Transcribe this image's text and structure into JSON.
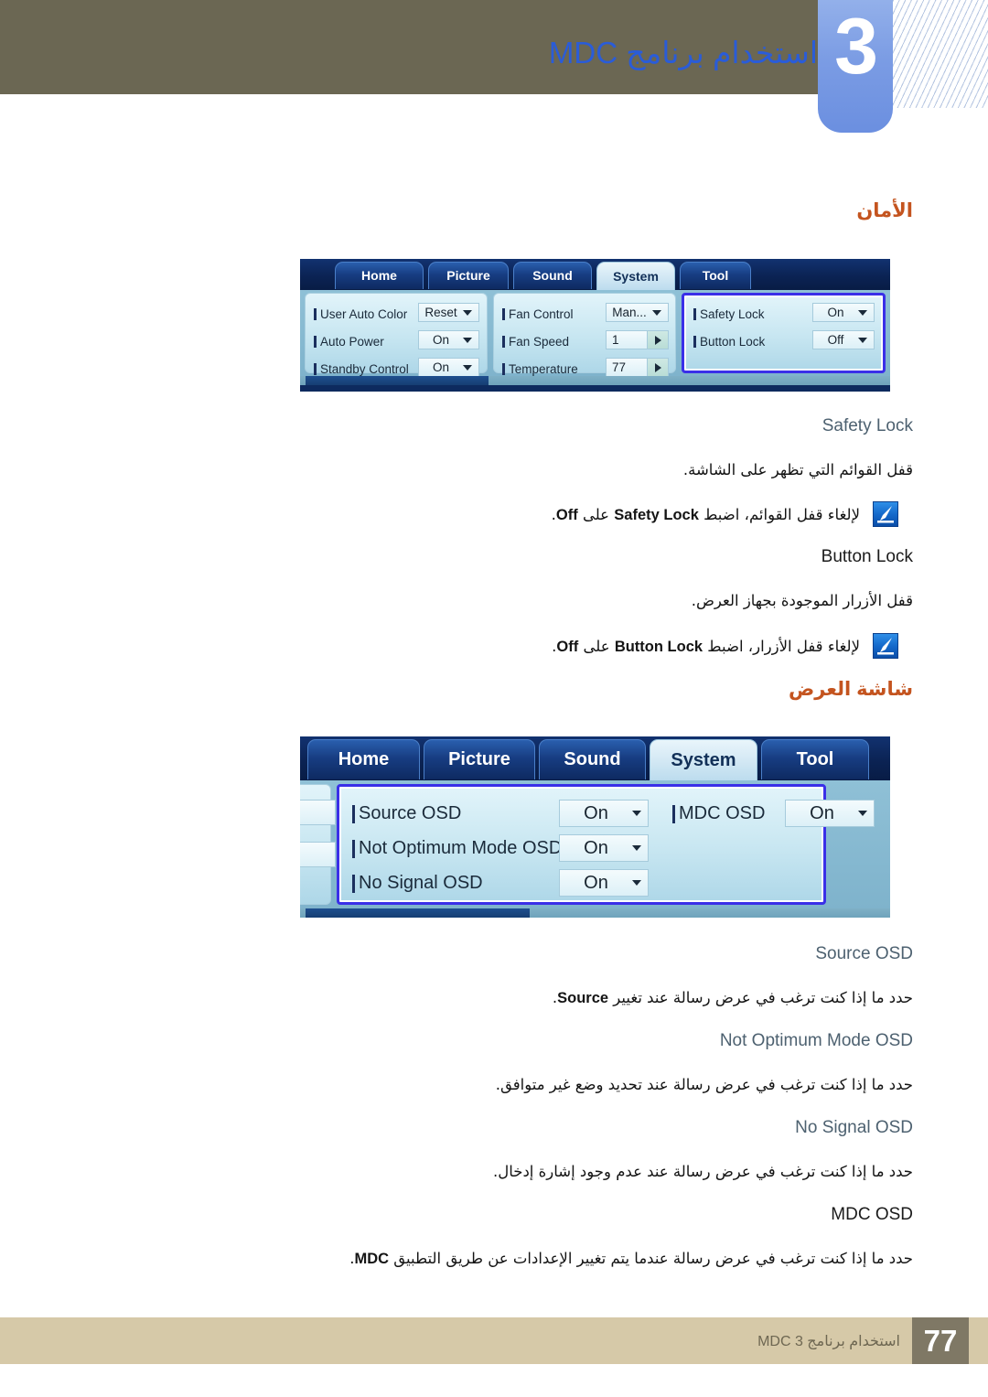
{
  "header": {
    "chapter_number": "3",
    "title": "استخدام برنامج MDC"
  },
  "sections": [
    {
      "heading": "الأمان",
      "panel": {
        "tabs": [
          {
            "label": "Home",
            "active": false
          },
          {
            "label": "Picture",
            "active": false
          },
          {
            "label": "Sound",
            "active": false
          },
          {
            "label": "System",
            "active": true
          },
          {
            "label": "Tool",
            "active": false
          }
        ],
        "groups": [
          {
            "highlighted": false,
            "rows": [
              {
                "label": "User Auto Color",
                "value": "Reset",
                "control": "dropdown"
              },
              {
                "label": "Auto Power",
                "value": "On",
                "control": "dropdown"
              },
              {
                "label": "Standby Control",
                "value": "On",
                "control": "dropdown"
              }
            ]
          },
          {
            "highlighted": false,
            "rows": [
              {
                "label": "Fan Control",
                "value": "Man...",
                "control": "dropdown"
              },
              {
                "label": "Fan Speed",
                "value": "1",
                "control": "spinner"
              },
              {
                "label": "Temperature",
                "value": "77",
                "control": "spinner"
              }
            ]
          },
          {
            "highlighted": true,
            "rows": [
              {
                "label": "Safety Lock",
                "value": "On",
                "control": "dropdown"
              },
              {
                "label": "Button Lock",
                "value": "Off",
                "control": "dropdown"
              }
            ]
          }
        ]
      },
      "entries": [
        {
          "term": "Safety Lock",
          "term_style": "muted",
          "description": "قفل القوائم التي تظهر على الشاشة.",
          "note": "لإلغاء قفل القوائم، اضبط Safety Lock على Off.",
          "note_pre": "لإلغاء قفل القوائم، اضبط ",
          "note_bold_1": "Safety Lock",
          "note_mid": " على ",
          "note_bold_2": "Off",
          "note_post": "."
        },
        {
          "term": "Button Lock",
          "term_style": "dark",
          "description": "قفل الأزرار الموجودة بجهاز العرض.",
          "note": "لإلغاء قفل الأزرار، اضبط Button Lock على Off.",
          "note_pre": "لإلغاء قفل الأزرار، اضبط ",
          "note_bold_1": "Button Lock",
          "note_mid": " على ",
          "note_bold_2": "Off",
          "note_post": "."
        }
      ]
    },
    {
      "heading": "شاشة العرض",
      "panel": {
        "tabs": [
          {
            "label": "Home",
            "active": false
          },
          {
            "label": "Picture",
            "active": false
          },
          {
            "label": "Sound",
            "active": false
          },
          {
            "label": "System",
            "active": true
          },
          {
            "label": "Tool",
            "active": false
          }
        ],
        "groups": [
          {
            "highlighted": true,
            "rows": [
              {
                "label": "Source OSD",
                "value": "On",
                "control": "dropdown"
              },
              {
                "label": "Not Optimum Mode OSD",
                "value": "On",
                "control": "dropdown"
              },
              {
                "label": "No Signal OSD",
                "value": "On",
                "control": "dropdown"
              }
            ]
          },
          {
            "highlighted": true,
            "rows": [
              {
                "label": "MDC OSD",
                "value": "On",
                "control": "dropdown"
              }
            ]
          }
        ]
      },
      "entries": [
        {
          "term": "Source OSD",
          "term_style": "muted",
          "description": "حدد ما إذا كنت ترغب في عرض رسالة عند تغيير Source.",
          "desc_pre": "حدد ما إذا كنت ترغب في عرض رسالة عند تغيير ",
          "desc_bold": "Source",
          "desc_post": "."
        },
        {
          "term": "Not Optimum Mode OSD",
          "term_style": "muted",
          "description": "حدد ما إذا كنت ترغب في عرض رسالة عند تحديد وضع غير متوافق."
        },
        {
          "term": "No Signal OSD",
          "term_style": "muted",
          "description": "حدد ما إذا كنت ترغب في عرض رسالة عند عدم وجود إشارة إدخال."
        },
        {
          "term": "MDC OSD",
          "term_style": "dark",
          "description": "حدد ما إذا كنت ترغب في عرض رسالة عندما يتم تغيير الإعدادات عن طريق التطبيق MDC.",
          "desc_pre": "حدد ما إذا كنت ترغب في عرض رسالة عندما يتم تغيير الإعدادات عن طريق التطبيق ",
          "desc_bold": "MDC",
          "desc_post": "."
        }
      ]
    }
  ],
  "footer": {
    "text": "استخدام برنامج MDC 3",
    "page": "77"
  },
  "colors": {
    "header_olive": "#6b6753",
    "chapter_blue": "#7b9ce4",
    "title_blue": "#2a5cd8",
    "heading_orange": "#c4541f",
    "highlight_border": "#3a2fe8",
    "footer_band": "#d6c9a8",
    "footer_num_bg": "#7f7865"
  }
}
